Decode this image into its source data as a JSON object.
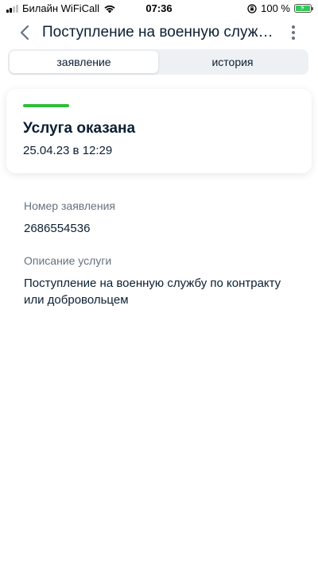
{
  "status_bar": {
    "carrier": "Билайн WiFiCall",
    "time": "07:36",
    "battery": "100 %"
  },
  "header": {
    "title": "Поступление на военную службу по контракту или добровольцем",
    "back_icon": "chevron-left-icon",
    "more_icon": "more-vertical-icon"
  },
  "tabs": [
    {
      "label": "заявление",
      "active": true
    },
    {
      "label": "история",
      "active": false
    }
  ],
  "status_card": {
    "indicator_color": "#2ebd3b",
    "title": "Услуга оказана",
    "date": "25.04.23 в 12:29"
  },
  "details": {
    "application_number_label": "Номер заявления",
    "application_number": "2686554536",
    "service_description_label": "Описание услуги",
    "service_description": "Поступление на военную службу по контракту или добровольцем"
  }
}
